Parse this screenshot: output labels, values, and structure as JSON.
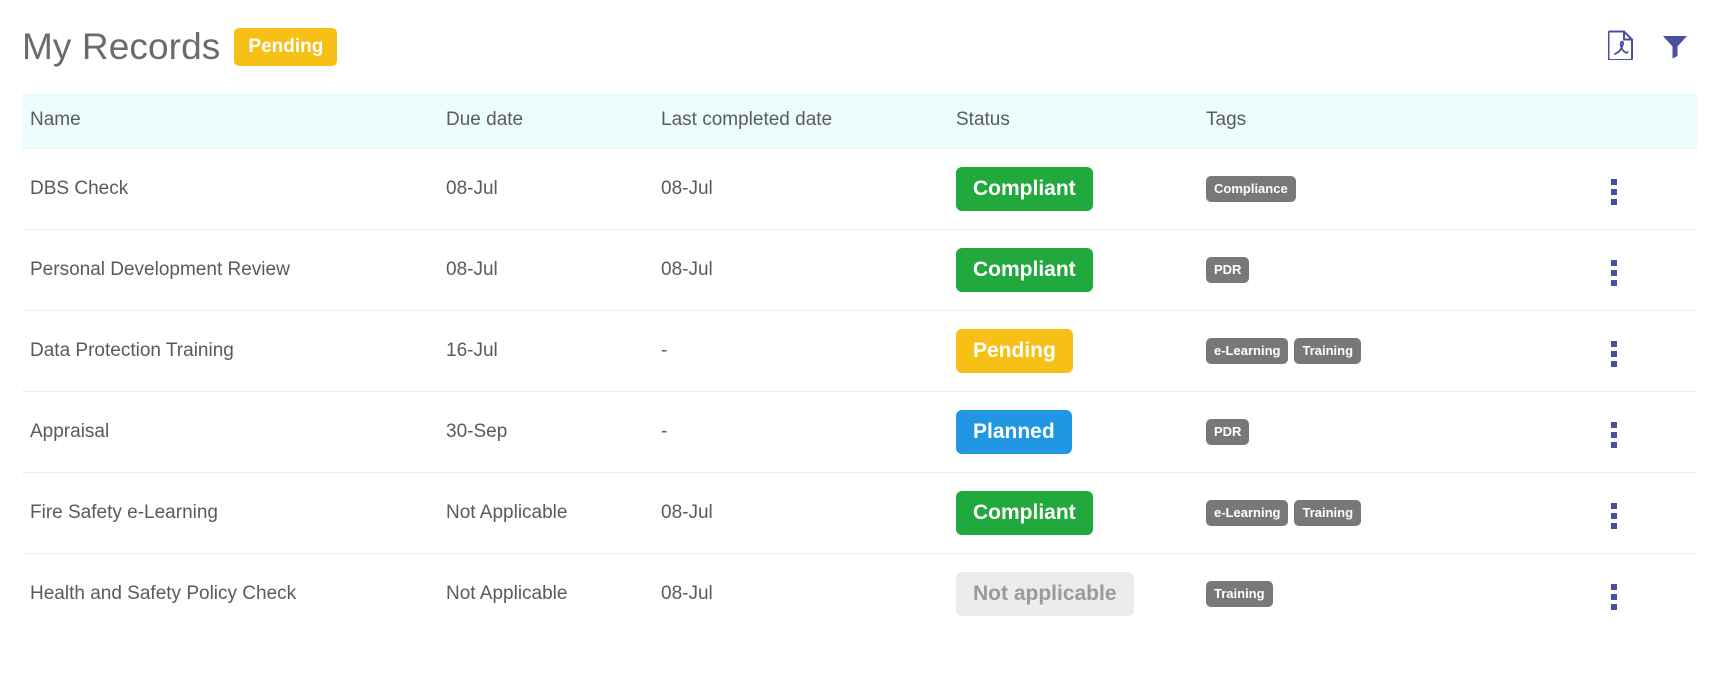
{
  "header": {
    "title": "My Records",
    "badge": "Pending",
    "badge_color": "#f7c017",
    "actions": [
      {
        "name": "export-pdf-button",
        "icon": "pdf-icon",
        "label": "Export to PDF"
      },
      {
        "name": "filter-button",
        "icon": "filter-funnel-icon",
        "label": "Filter"
      }
    ]
  },
  "table": {
    "columns": [
      "Name",
      "Due date",
      "Last completed date",
      "Status",
      "Tags"
    ],
    "row_menu_icon": "kebab-menu-icon",
    "status_colors": {
      "Compliant": "#22a93e",
      "Pending": "#f7c017",
      "Planned": "#2196e3",
      "Not applicable": "#ececec"
    },
    "rows": [
      {
        "name": "DBS Check",
        "due_date": "08-Jul",
        "last_completed_date": "08-Jul",
        "status": "Compliant",
        "status_kind": "compliant",
        "tags": [
          "Compliance"
        ]
      },
      {
        "name": "Personal Development Review",
        "due_date": "08-Jul",
        "last_completed_date": "08-Jul",
        "status": "Compliant",
        "status_kind": "compliant",
        "tags": [
          "PDR"
        ]
      },
      {
        "name": "Data Protection Training",
        "due_date": "16-Jul",
        "last_completed_date": "-",
        "status": "Pending",
        "status_kind": "pending",
        "tags": [
          "e-Learning",
          "Training"
        ]
      },
      {
        "name": "Appraisal",
        "due_date": "30-Sep",
        "last_completed_date": "-",
        "status": "Planned",
        "status_kind": "planned",
        "tags": [
          "PDR"
        ]
      },
      {
        "name": "Fire Safety e-Learning",
        "due_date": "Not Applicable",
        "last_completed_date": "08-Jul",
        "status": "Compliant",
        "status_kind": "compliant",
        "tags": [
          "e-Learning",
          "Training"
        ]
      },
      {
        "name": "Health and Safety Policy Check",
        "due_date": "Not Applicable",
        "last_completed_date": "08-Jul",
        "status": "Not applicable",
        "status_kind": "na",
        "tags": [
          "Training"
        ]
      }
    ]
  }
}
